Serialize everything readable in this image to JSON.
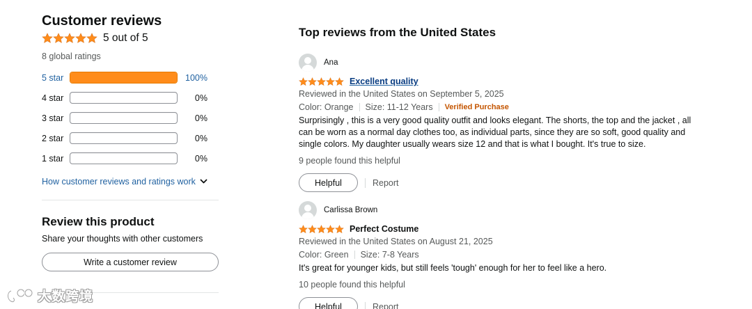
{
  "summary": {
    "title": "Customer reviews",
    "rating": 5,
    "rating_text": "5 out of 5",
    "global_ratings": "8 global ratings",
    "histogram": [
      {
        "label": "5 star",
        "percent": 100,
        "percent_text": "100%"
      },
      {
        "label": "4 star",
        "percent": 0,
        "percent_text": "0%"
      },
      {
        "label": "3 star",
        "percent": 0,
        "percent_text": "0%"
      },
      {
        "label": "2 star",
        "percent": 0,
        "percent_text": "0%"
      },
      {
        "label": "1 star",
        "percent": 0,
        "percent_text": "0%"
      }
    ],
    "how_link": "How customer reviews and ratings work"
  },
  "review_product": {
    "title": "Review this product",
    "subtitle": "Share your thoughts with other customers",
    "button": "Write a customer review"
  },
  "top_reviews": {
    "title": "Top reviews from the United States",
    "reviews": [
      {
        "name": "Ana",
        "rating": 5,
        "title": "Excellent quality",
        "date": "Reviewed in the United States on September 5, 2025",
        "color": "Color: Orange",
        "size": "Size: 11-12 Years",
        "verified": "Verified Purchase",
        "body": "Surprisingly , this is a very good quality outfit and looks elegant. The shorts, the top and the jacket , all can be worn as a normal day clothes too, as individual parts, since they are so soft, good quality and single colors. My daughter usually wears size 12 and that is what I bought. It's true to size.",
        "helpful_count": "9 people found this helpful",
        "helpful_button": "Helpful",
        "report": "Report"
      },
      {
        "name": "Carlissa Brown",
        "rating": 5,
        "title": "Perfect Costume",
        "date": "Reviewed in the United States on August 21, 2025",
        "color": "Color: Green",
        "size": "Size: 7-8 Years",
        "body": "It's great for younger kids, but still feels 'tough' enough for her to feel like a hero.",
        "helpful_count": "10 people found this helpful",
        "helpful_button": "Helpful",
        "report": "Report"
      }
    ]
  },
  "watermark": {
    "text": "大数跨境"
  },
  "colors": {
    "star": "#ff8c1a",
    "link": "#2162a1",
    "verified": "#c45500"
  },
  "icons": {
    "star": "star-icon",
    "chevron": "chevron-down-icon",
    "avatar": "avatar-icon"
  }
}
